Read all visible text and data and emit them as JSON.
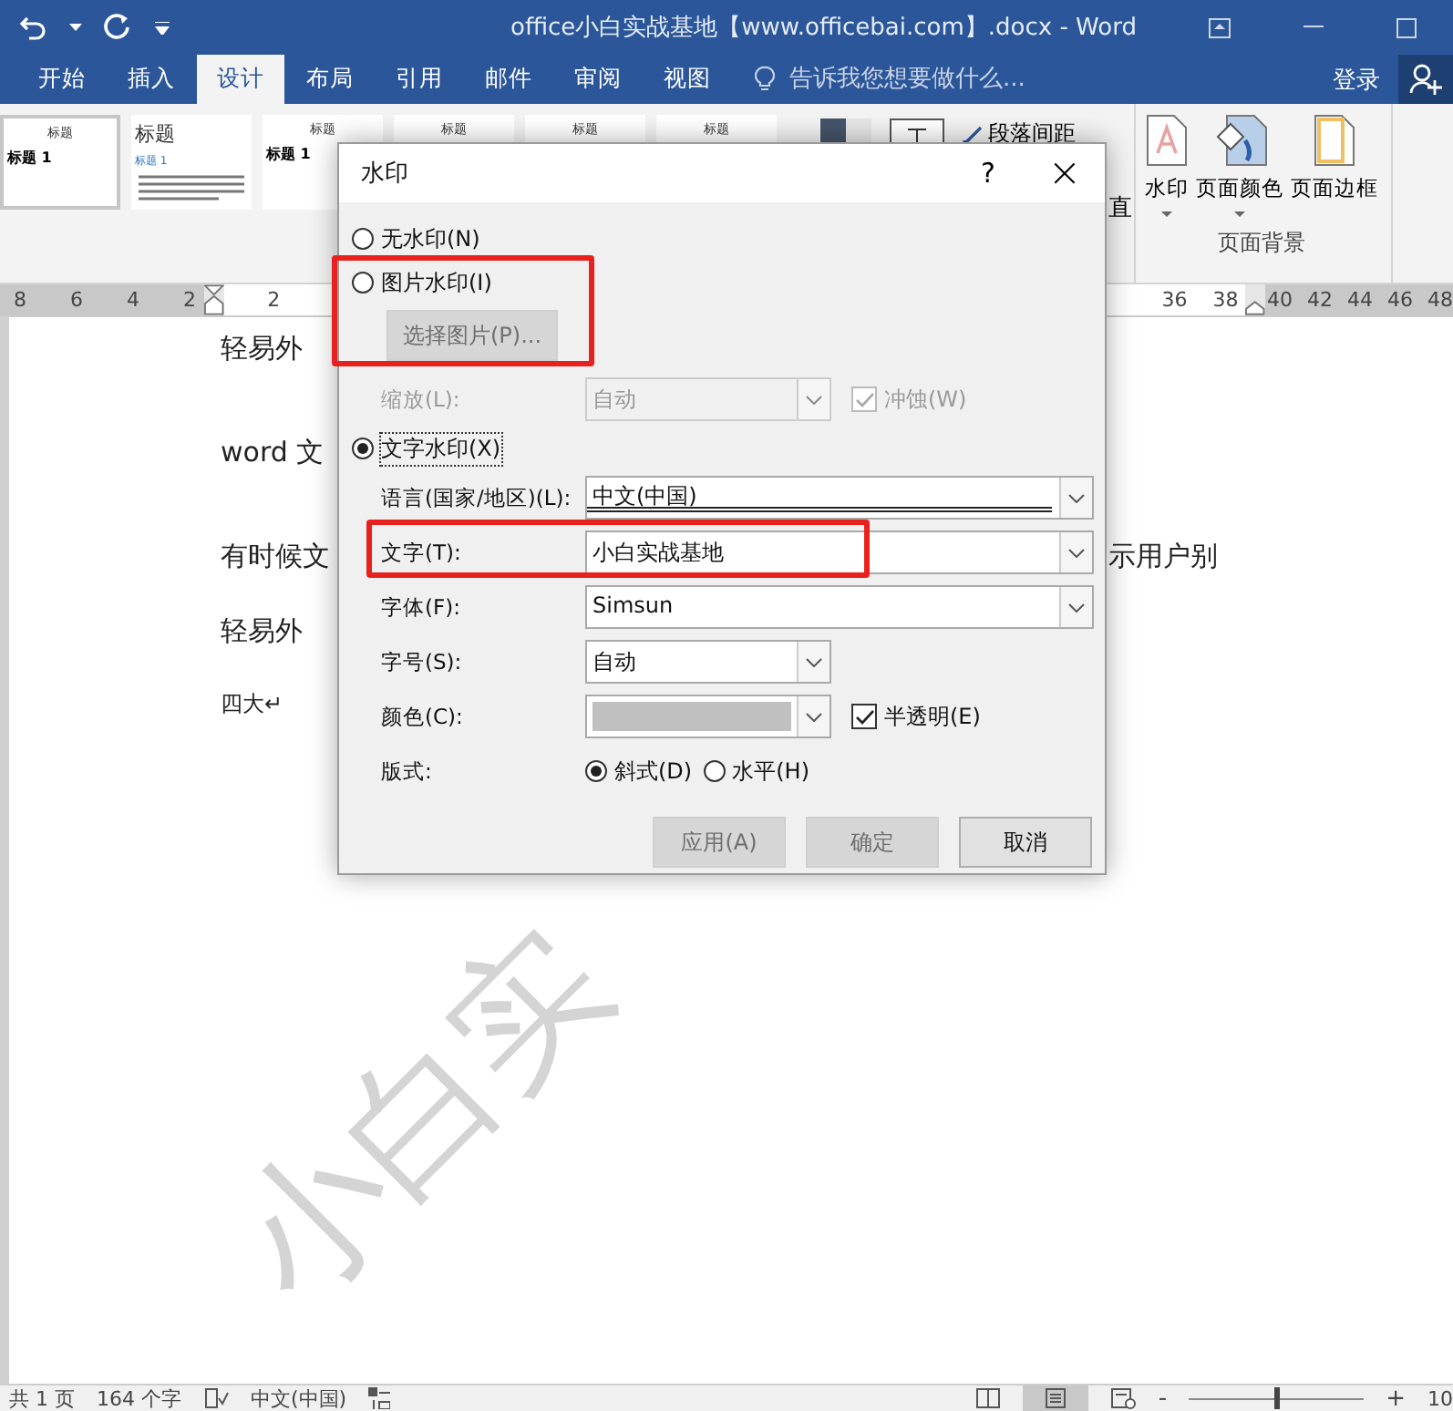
{
  "title_bar": {
    "title": "office小白实战基地【www.officebai.com】.docx - Word"
  },
  "tabs": [
    {
      "label": "开始",
      "selected": false
    },
    {
      "label": "插入",
      "selected": false
    },
    {
      "label": "设计",
      "selected": true
    },
    {
      "label": "布局",
      "selected": false
    },
    {
      "label": "引用",
      "selected": false
    },
    {
      "label": "邮件",
      "selected": false
    },
    {
      "label": "审阅",
      "selected": false
    },
    {
      "label": "视图",
      "selected": false
    }
  ],
  "tell_me": {
    "placeholder": "告诉我您想要做什么..."
  },
  "sign_in": "登录",
  "ribbon": {
    "gallery": [
      {
        "heading": "标题",
        "sub": "标题 1",
        "kind": "plain"
      },
      {
        "heading": "标题",
        "sub": "标题 1",
        "kind": "lines"
      },
      {
        "heading": "标题",
        "sub": "标题 1",
        "kind": "plain"
      },
      {
        "heading": "标题",
        "kind": "plain"
      },
      {
        "heading": "标题",
        "kind": "plain"
      },
      {
        "heading": "标题",
        "kind": "plain"
      }
    ],
    "paragraph_spacing": "段落间距",
    "partial_label": "直",
    "buttons": [
      {
        "label": "水印",
        "kind": "watermark",
        "dropdown": true
      },
      {
        "label": "页面颜色",
        "kind": "color",
        "dropdown": true
      },
      {
        "label": "页面边框",
        "kind": "border",
        "dropdown": false
      }
    ],
    "group_label": "页面背景"
  },
  "ruler": {
    "left_ticks": [
      "8",
      "6",
      "4",
      "2"
    ],
    "inner_ticks": [
      "2"
    ],
    "right_ticks": [
      "36",
      "38",
      "40",
      "42",
      "44",
      "46",
      "48"
    ]
  },
  "document": {
    "paragraphs": [
      {
        "text": "轻易外"
      },
      {
        "text": "word 文"
      },
      {
        "text": "有时候文",
        "right": "示用户别"
      },
      {
        "text": "轻易外"
      },
      {
        "text": "四大↵"
      }
    ],
    "watermark": "小白实"
  },
  "dialog": {
    "title": "水印",
    "help": "?",
    "close": "×",
    "no_watermark": {
      "label": "无水印(N)",
      "selected": false
    },
    "picture_watermark": {
      "label": "图片水印(I)",
      "selected": false,
      "button": "选择图片(P)...",
      "scale_label": "缩放(L):",
      "scale_value": "自动",
      "washout": {
        "label": "冲蚀(W)",
        "checked": true,
        "disabled": true
      }
    },
    "text_watermark": {
      "label": "文字水印(X)",
      "selected": true
    },
    "fields": [
      {
        "label": "语言(国家/地区)(L):",
        "value": "中文(中国)",
        "kind": "wide"
      },
      {
        "label": "文字(T):",
        "value": "小白实战基地",
        "kind": "wide"
      },
      {
        "label": "字体(F):",
        "value": "Simsun",
        "kind": "wide"
      },
      {
        "label": "字号(S):",
        "value": "自动",
        "kind": "narrow"
      },
      {
        "label": "颜色(C):",
        "kind": "color",
        "color": "#c0c0c0"
      }
    ],
    "semitransparent": {
      "label": "半透明(E)",
      "checked": true
    },
    "layout_label": "版式:",
    "layout_options": [
      {
        "label": "斜式(D)",
        "selected": true
      },
      {
        "label": "水平(H)",
        "selected": false
      }
    ],
    "buttons": [
      {
        "label": "应用(A)",
        "disabled": true
      },
      {
        "label": "确定",
        "disabled": true
      },
      {
        "label": "取消",
        "disabled": false
      }
    ]
  },
  "status_bar": {
    "pages": "共 1 页",
    "words": "164 个字",
    "language": "中文(中国)",
    "zoom": {
      "level": 0.5,
      "minus": "-",
      "plus": "+",
      "percent": "10"
    }
  }
}
